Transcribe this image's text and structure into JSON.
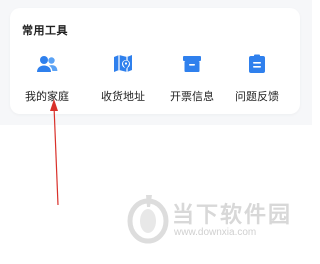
{
  "card": {
    "title": "常用工具",
    "tools": [
      {
        "label": "我的家庭",
        "icon": "family-icon"
      },
      {
        "label": "收货地址",
        "icon": "map-pin-icon"
      },
      {
        "label": "开票信息",
        "icon": "invoice-icon"
      },
      {
        "label": "问题反馈",
        "icon": "feedback-icon"
      }
    ]
  },
  "watermark": {
    "title": "当下软件园",
    "url": "www.downxia.com"
  },
  "colors": {
    "accent": "#2f80ed",
    "arrow": "#d9302a",
    "page_bg": "#f6f7f9",
    "watermark": "#d8d8d8"
  }
}
